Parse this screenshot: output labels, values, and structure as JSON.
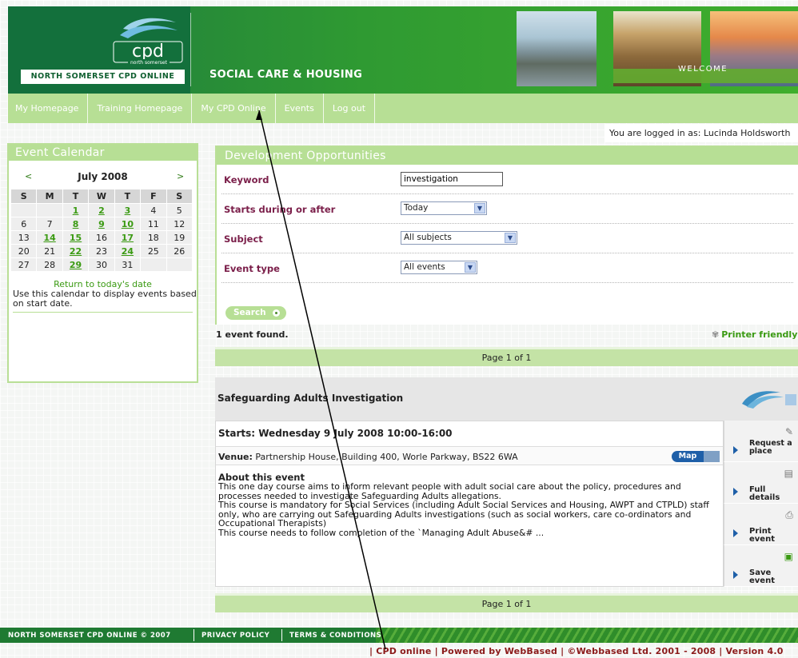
{
  "header": {
    "logo_text": "cpd",
    "logo_subtext": "north somerset",
    "site_name": "NORTH SOMERSET CPD ONLINE",
    "department": "SOCIAL CARE & HOUSING",
    "welcome": "WELCOME"
  },
  "nav": {
    "items": [
      {
        "label": "My Homepage"
      },
      {
        "label": "Training Homepage"
      },
      {
        "label": "My CPD Online"
      },
      {
        "label": "Events"
      },
      {
        "label": "Log out"
      }
    ]
  },
  "session": {
    "logged_in_text": "You are logged in as: Lucinda Holdsworth"
  },
  "calendar": {
    "heading": "Event Calendar",
    "prev": "<",
    "next": ">",
    "month": "July 2008",
    "weekdays": [
      "S",
      "M",
      "T",
      "W",
      "T",
      "F",
      "S"
    ],
    "weeks": [
      [
        {
          "d": ""
        },
        {
          "d": ""
        },
        {
          "d": "1",
          "e": true
        },
        {
          "d": "2",
          "e": true
        },
        {
          "d": "3",
          "e": true
        },
        {
          "d": "4"
        },
        {
          "d": "5"
        }
      ],
      [
        {
          "d": "6"
        },
        {
          "d": "7"
        },
        {
          "d": "8",
          "e": true
        },
        {
          "d": "9",
          "e": true
        },
        {
          "d": "10",
          "e": true
        },
        {
          "d": "11"
        },
        {
          "d": "12"
        }
      ],
      [
        {
          "d": "13"
        },
        {
          "d": "14",
          "e": true
        },
        {
          "d": "15",
          "e": true
        },
        {
          "d": "16"
        },
        {
          "d": "17",
          "e": true
        },
        {
          "d": "18"
        },
        {
          "d": "19"
        }
      ],
      [
        {
          "d": "20"
        },
        {
          "d": "21"
        },
        {
          "d": "22",
          "e": true
        },
        {
          "d": "23"
        },
        {
          "d": "24",
          "e": true
        },
        {
          "d": "25"
        },
        {
          "d": "26"
        }
      ],
      [
        {
          "d": "27"
        },
        {
          "d": "28"
        },
        {
          "d": "29",
          "e": true
        },
        {
          "d": "30"
        },
        {
          "d": "31"
        },
        {
          "d": ""
        },
        {
          "d": ""
        }
      ]
    ],
    "return_link": "Return to today's date",
    "note": "Use this calendar to display events based on start date."
  },
  "search": {
    "heading": "Development Opportunities",
    "keyword_label": "Keyword",
    "keyword_value": "investigation",
    "starts_label": "Starts during or after",
    "starts_value": "Today",
    "subject_label": "Subject",
    "subject_value": "All subjects",
    "event_type_label": "Event type",
    "event_type_value": "All events",
    "search_button": "Search"
  },
  "results": {
    "count_text": "1 event found.",
    "printer_friendly": "Printer friendly",
    "pager_text": "Page 1 of 1"
  },
  "event": {
    "title": "Safeguarding Adults Investigation",
    "starts": "Starts: Wednesday 9 July 2008 10:00-16:00",
    "venue_label": "Venue:",
    "venue": "Partnership House, Building 400, Worle Parkway, BS22 6WA",
    "map_button": "Map",
    "about_heading": "About this event",
    "about_lines": [
      "This one day course aims to inform relevant people with adult social care about the policy, procedures and processes needed to investigate Safeguarding Adults allegations.",
      "This course is mandatory for Social Services (including Adult Social Services and Housing, AWPT and CTPLD) staff only, who are carrying out Safeguarding Adults investigations (such as social workers, care co-ordinators and Occupational Therapists)",
      "This course needs to follow completion of the `Managing Adult Abuse&# ..."
    ],
    "actions": [
      {
        "label": "Request a place"
      },
      {
        "label": "Full details"
      },
      {
        "label": "Print event"
      },
      {
        "label": "Save event"
      }
    ]
  },
  "footer": {
    "copyright": "NORTH SOMERSET CPD ONLINE © 2007",
    "privacy": "PRIVACY POLICY",
    "terms": "TERMS & CONDITIONS",
    "powered": "| CPD online | Powered by WebBased | ©Webbased Ltd. 2001 - 2008 | Version 4.0"
  },
  "colors": {
    "brand_green": "#1e7a3e",
    "nav_green": "#b7df95",
    "label_maroon": "#7b1f4a",
    "link_green": "#3a9a12",
    "action_blue": "#1e5fa8"
  }
}
